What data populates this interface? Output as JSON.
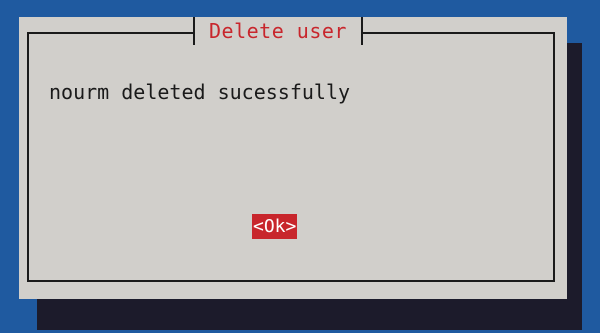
{
  "dialog": {
    "title": "Delete user",
    "message": "nourm deleted sucessfully",
    "ok_label": "<Ok>"
  },
  "colors": {
    "background": "#1f5aa0",
    "dialog_bg": "#d1cfcb",
    "shadow": "#1c1b2b",
    "accent": "#c8262c",
    "text": "#1a1a1a"
  }
}
